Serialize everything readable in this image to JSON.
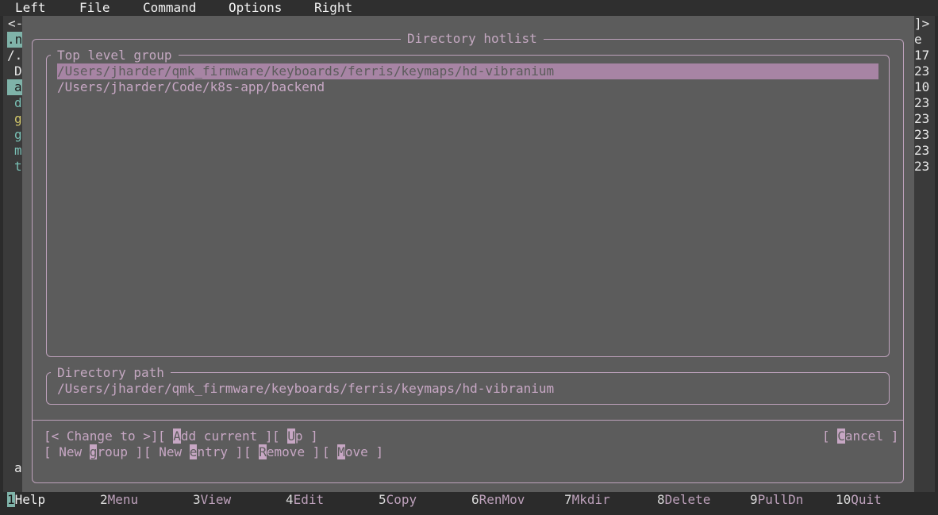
{
  "menubar": {
    "items": [
      "Left",
      "File",
      "Command",
      "Options",
      "Right"
    ]
  },
  "background": {
    "left_marker": "<-",
    "right_marker": "]>",
    "left_fragments": [
      ".n",
      "/.",
      "D",
      "a",
      "d",
      "g",
      "g",
      "m",
      "t"
    ],
    "right_fragments": [
      "e",
      "17",
      "23",
      "10",
      "23",
      "23",
      "23",
      "23",
      "23"
    ],
    "bottom_fragment": "a"
  },
  "dialog": {
    "title": "Directory hotlist",
    "group_title": "Top level group",
    "entries": [
      "/Users/jharder/qmk_firmware/keyboards/ferris/keymaps/hd-vibranium",
      "/Users/jharder/Code/k8s-app/backend"
    ],
    "path_title": "Directory path",
    "path_value": "/Users/jharder/qmk_firmware/keyboards/ferris/keymaps/hd-vibranium",
    "buttons": {
      "change_to": "[< Change to >]",
      "add_current": {
        "pre": "[ ",
        "hot": "A",
        "post": "dd current ]"
      },
      "up": {
        "pre": "[ ",
        "hot": "U",
        "post": "p ]"
      },
      "cancel": {
        "pre": "[ ",
        "hot": "C",
        "post": "ancel ]"
      },
      "new_group": {
        "pre": "[ New ",
        "hot": "g",
        "post": "roup ]"
      },
      "new_entry": {
        "pre": "[ New ",
        "hot": "e",
        "post": "ntry ]"
      },
      "remove": {
        "pre": "[ ",
        "hot": "R",
        "post": "emove ]"
      },
      "move": {
        "pre": "[ ",
        "hot": "M",
        "post": "ove ]"
      }
    }
  },
  "fkeys": [
    {
      "num": "1",
      "label": "Help"
    },
    {
      "num": "2",
      "label": "Menu"
    },
    {
      "num": "3",
      "label": "View"
    },
    {
      "num": "4",
      "label": "Edit"
    },
    {
      "num": "5",
      "label": "Copy"
    },
    {
      "num": "6",
      "label": "RenMov"
    },
    {
      "num": "7",
      "label": "Mkdir"
    },
    {
      "num": "8",
      "label": "Delete"
    },
    {
      "num": "9",
      "label": "PullDn"
    },
    {
      "num": "10",
      "label": "Quit"
    }
  ]
}
